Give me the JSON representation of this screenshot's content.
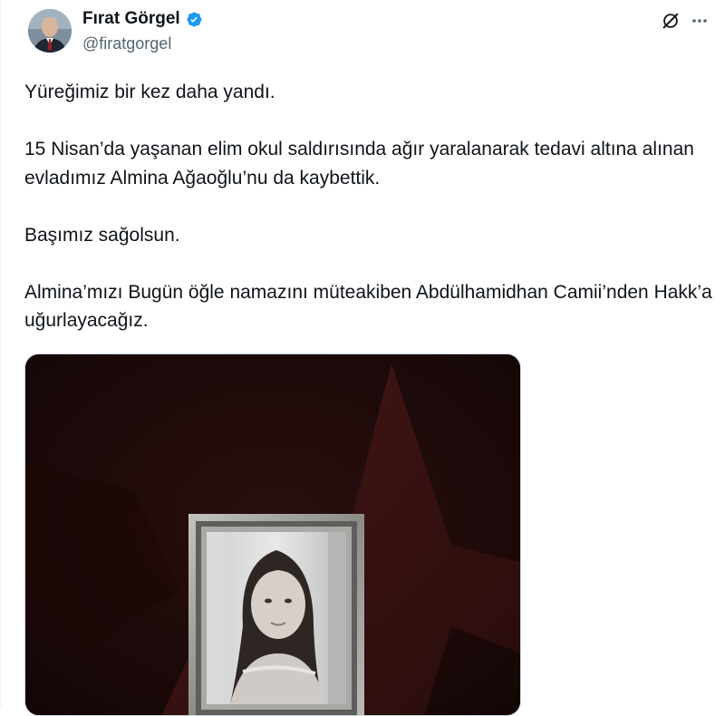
{
  "author": {
    "name": "Fırat Görgel",
    "handle": "@firatgorgel",
    "verified": true,
    "avatar_icon": "avatar-photo",
    "verified_icon": "verified-badge-icon",
    "verified_color": "#1d9bf0"
  },
  "actions": {
    "grok_icon": "grok-icon",
    "more_icon": "more-options-icon"
  },
  "tweet": {
    "paragraphs": [
      "Yüreğimiz bir kez daha yandı.",
      "15 Nisan’da yaşanan elim okul saldırısında ağır yaralanarak tedavi altına alınan evladımız Almina Ağaoğlu’nu da kaybettik.",
      "Başımız sağolsun.",
      "Almina’mızı Bugün öğle namazını müteakiben Abdülhamidhan Camii’nden Hakk’a uğurlayacağız."
    ]
  },
  "media": {
    "description_icon": "memorial-image",
    "colors": {
      "background": "#1a0909",
      "star": "#3a1414",
      "frame": "#9a9a96"
    }
  }
}
